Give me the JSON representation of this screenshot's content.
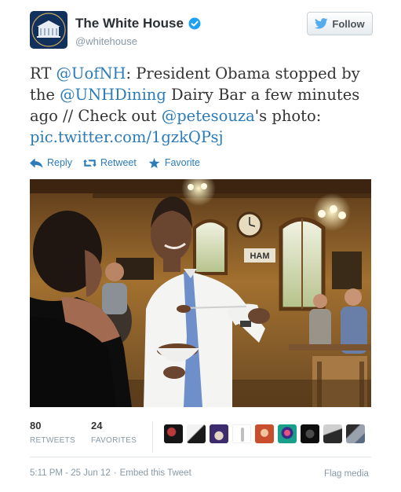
{
  "user": {
    "name": "The White House",
    "handle": "@whitehouse",
    "follow_label": "Follow"
  },
  "tweet": {
    "t1": "RT ",
    "mention1": "@UofNH",
    "t2": ": President Obama stopped by the ",
    "mention2": "@UNHDining",
    "t3": " Dairy Bar a few minutes ago // Check out ",
    "mention3": "@petesouza",
    "t4": "'s photo: ",
    "link": "pic.twitter.com/1gzkQPsj"
  },
  "actions": {
    "reply": "Reply",
    "retweet": "Retweet",
    "favorite": "Favorite"
  },
  "photo": {
    "sign_text": "HAM"
  },
  "stats": {
    "retweets_count": "80",
    "retweets_label": "RETWEETS",
    "favorites_count": "24",
    "favorites_label": "FAVORITES"
  },
  "footer": {
    "timestamp": "5:11 PM - 25 Jun 12",
    "separator": "·",
    "embed": "Embed this Tweet",
    "flag": "Flag media"
  },
  "colors": {
    "link": "#2b7bb9",
    "muted": "#8899a6",
    "verified": "#1da1f2"
  }
}
